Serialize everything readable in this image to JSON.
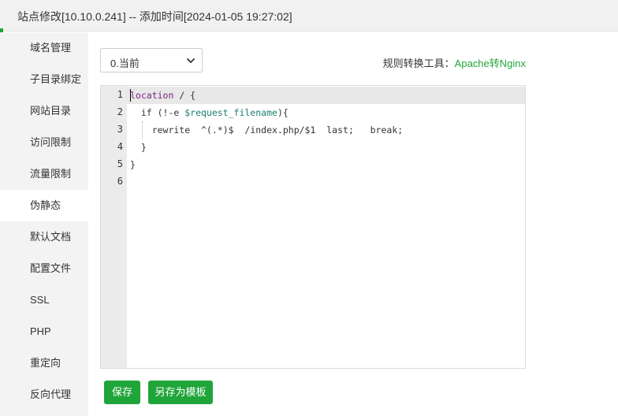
{
  "window": {
    "title": "站点修改[10.10.0.241] -- 添加时间[2024-01-05 19:27:02]"
  },
  "sidebar": {
    "items": [
      {
        "label": "域名管理"
      },
      {
        "label": "子目录绑定"
      },
      {
        "label": "网站目录"
      },
      {
        "label": "访问限制"
      },
      {
        "label": "流量限制"
      },
      {
        "label": "伪静态"
      },
      {
        "label": "默认文档"
      },
      {
        "label": "配置文件"
      },
      {
        "label": "SSL"
      },
      {
        "label": "PHP"
      },
      {
        "label": "重定向"
      },
      {
        "label": "反向代理"
      }
    ],
    "active": "伪静态"
  },
  "template_select": {
    "value": "0.当前"
  },
  "convert_tool": {
    "label": "规则转换工具：",
    "link": "Apache转Nginx"
  },
  "editor": {
    "line_numbers": [
      "1",
      "2",
      "3",
      "4",
      "5",
      "6"
    ],
    "lines": [
      {
        "parts": [
          {
            "t": "location",
            "c": "kw"
          },
          {
            "t": " / {",
            "c": ""
          }
        ]
      },
      {
        "parts": [
          {
            "t": "  if (!-e ",
            "c": ""
          },
          {
            "t": "$request_filename",
            "c": "var"
          },
          {
            "t": "){",
            "c": ""
          }
        ]
      },
      {
        "parts": [
          {
            "t": "    rewrite  ^(.*)$  /index.php/$1  last;   break;",
            "c": ""
          }
        ]
      },
      {
        "parts": [
          {
            "t": "  }",
            "c": ""
          }
        ]
      },
      {
        "parts": [
          {
            "t": "}",
            "c": ""
          }
        ]
      },
      {
        "parts": [
          {
            "t": "",
            "c": ""
          }
        ]
      }
    ]
  },
  "actions": {
    "save": "保存",
    "save_as_template": "另存为模板"
  },
  "colors": {
    "accent": "#20a53a"
  }
}
